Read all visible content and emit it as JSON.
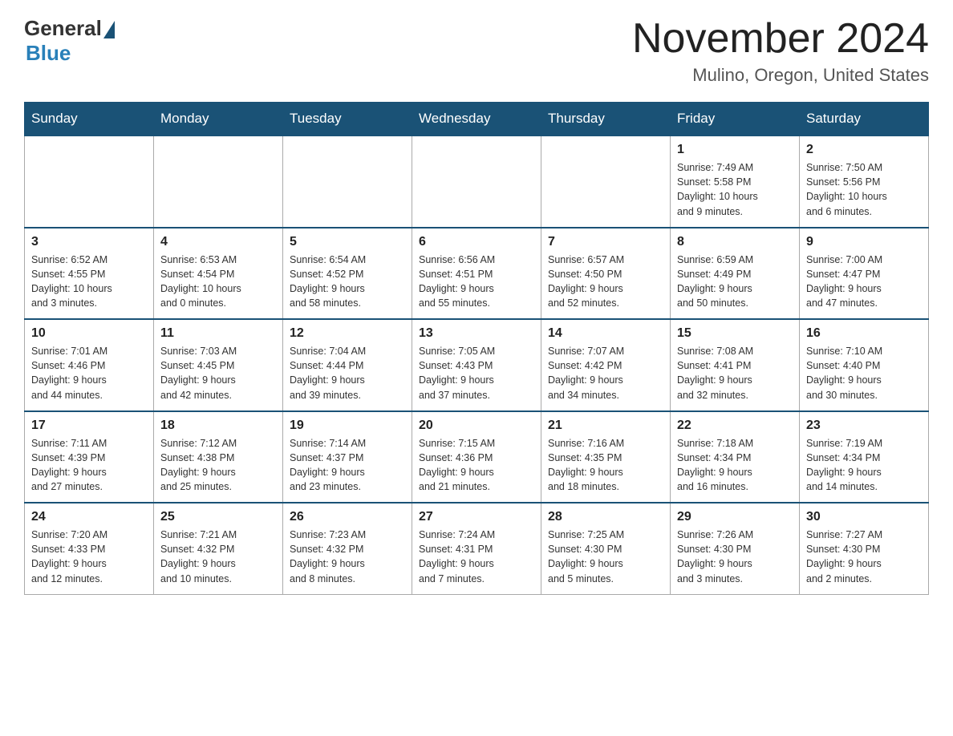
{
  "header": {
    "logo": {
      "general": "General",
      "blue": "Blue"
    },
    "title": "November 2024",
    "location": "Mulino, Oregon, United States"
  },
  "days_of_week": [
    "Sunday",
    "Monday",
    "Tuesday",
    "Wednesday",
    "Thursday",
    "Friday",
    "Saturday"
  ],
  "weeks": [
    [
      {
        "day": "",
        "info": ""
      },
      {
        "day": "",
        "info": ""
      },
      {
        "day": "",
        "info": ""
      },
      {
        "day": "",
        "info": ""
      },
      {
        "day": "",
        "info": ""
      },
      {
        "day": "1",
        "info": "Sunrise: 7:49 AM\nSunset: 5:58 PM\nDaylight: 10 hours\nand 9 minutes."
      },
      {
        "day": "2",
        "info": "Sunrise: 7:50 AM\nSunset: 5:56 PM\nDaylight: 10 hours\nand 6 minutes."
      }
    ],
    [
      {
        "day": "3",
        "info": "Sunrise: 6:52 AM\nSunset: 4:55 PM\nDaylight: 10 hours\nand 3 minutes."
      },
      {
        "day": "4",
        "info": "Sunrise: 6:53 AM\nSunset: 4:54 PM\nDaylight: 10 hours\nand 0 minutes."
      },
      {
        "day": "5",
        "info": "Sunrise: 6:54 AM\nSunset: 4:52 PM\nDaylight: 9 hours\nand 58 minutes."
      },
      {
        "day": "6",
        "info": "Sunrise: 6:56 AM\nSunset: 4:51 PM\nDaylight: 9 hours\nand 55 minutes."
      },
      {
        "day": "7",
        "info": "Sunrise: 6:57 AM\nSunset: 4:50 PM\nDaylight: 9 hours\nand 52 minutes."
      },
      {
        "day": "8",
        "info": "Sunrise: 6:59 AM\nSunset: 4:49 PM\nDaylight: 9 hours\nand 50 minutes."
      },
      {
        "day": "9",
        "info": "Sunrise: 7:00 AM\nSunset: 4:47 PM\nDaylight: 9 hours\nand 47 minutes."
      }
    ],
    [
      {
        "day": "10",
        "info": "Sunrise: 7:01 AM\nSunset: 4:46 PM\nDaylight: 9 hours\nand 44 minutes."
      },
      {
        "day": "11",
        "info": "Sunrise: 7:03 AM\nSunset: 4:45 PM\nDaylight: 9 hours\nand 42 minutes."
      },
      {
        "day": "12",
        "info": "Sunrise: 7:04 AM\nSunset: 4:44 PM\nDaylight: 9 hours\nand 39 minutes."
      },
      {
        "day": "13",
        "info": "Sunrise: 7:05 AM\nSunset: 4:43 PM\nDaylight: 9 hours\nand 37 minutes."
      },
      {
        "day": "14",
        "info": "Sunrise: 7:07 AM\nSunset: 4:42 PM\nDaylight: 9 hours\nand 34 minutes."
      },
      {
        "day": "15",
        "info": "Sunrise: 7:08 AM\nSunset: 4:41 PM\nDaylight: 9 hours\nand 32 minutes."
      },
      {
        "day": "16",
        "info": "Sunrise: 7:10 AM\nSunset: 4:40 PM\nDaylight: 9 hours\nand 30 minutes."
      }
    ],
    [
      {
        "day": "17",
        "info": "Sunrise: 7:11 AM\nSunset: 4:39 PM\nDaylight: 9 hours\nand 27 minutes."
      },
      {
        "day": "18",
        "info": "Sunrise: 7:12 AM\nSunset: 4:38 PM\nDaylight: 9 hours\nand 25 minutes."
      },
      {
        "day": "19",
        "info": "Sunrise: 7:14 AM\nSunset: 4:37 PM\nDaylight: 9 hours\nand 23 minutes."
      },
      {
        "day": "20",
        "info": "Sunrise: 7:15 AM\nSunset: 4:36 PM\nDaylight: 9 hours\nand 21 minutes."
      },
      {
        "day": "21",
        "info": "Sunrise: 7:16 AM\nSunset: 4:35 PM\nDaylight: 9 hours\nand 18 minutes."
      },
      {
        "day": "22",
        "info": "Sunrise: 7:18 AM\nSunset: 4:34 PM\nDaylight: 9 hours\nand 16 minutes."
      },
      {
        "day": "23",
        "info": "Sunrise: 7:19 AM\nSunset: 4:34 PM\nDaylight: 9 hours\nand 14 minutes."
      }
    ],
    [
      {
        "day": "24",
        "info": "Sunrise: 7:20 AM\nSunset: 4:33 PM\nDaylight: 9 hours\nand 12 minutes."
      },
      {
        "day": "25",
        "info": "Sunrise: 7:21 AM\nSunset: 4:32 PM\nDaylight: 9 hours\nand 10 minutes."
      },
      {
        "day": "26",
        "info": "Sunrise: 7:23 AM\nSunset: 4:32 PM\nDaylight: 9 hours\nand 8 minutes."
      },
      {
        "day": "27",
        "info": "Sunrise: 7:24 AM\nSunset: 4:31 PM\nDaylight: 9 hours\nand 7 minutes."
      },
      {
        "day": "28",
        "info": "Sunrise: 7:25 AM\nSunset: 4:30 PM\nDaylight: 9 hours\nand 5 minutes."
      },
      {
        "day": "29",
        "info": "Sunrise: 7:26 AM\nSunset: 4:30 PM\nDaylight: 9 hours\nand 3 minutes."
      },
      {
        "day": "30",
        "info": "Sunrise: 7:27 AM\nSunset: 4:30 PM\nDaylight: 9 hours\nand 2 minutes."
      }
    ]
  ]
}
